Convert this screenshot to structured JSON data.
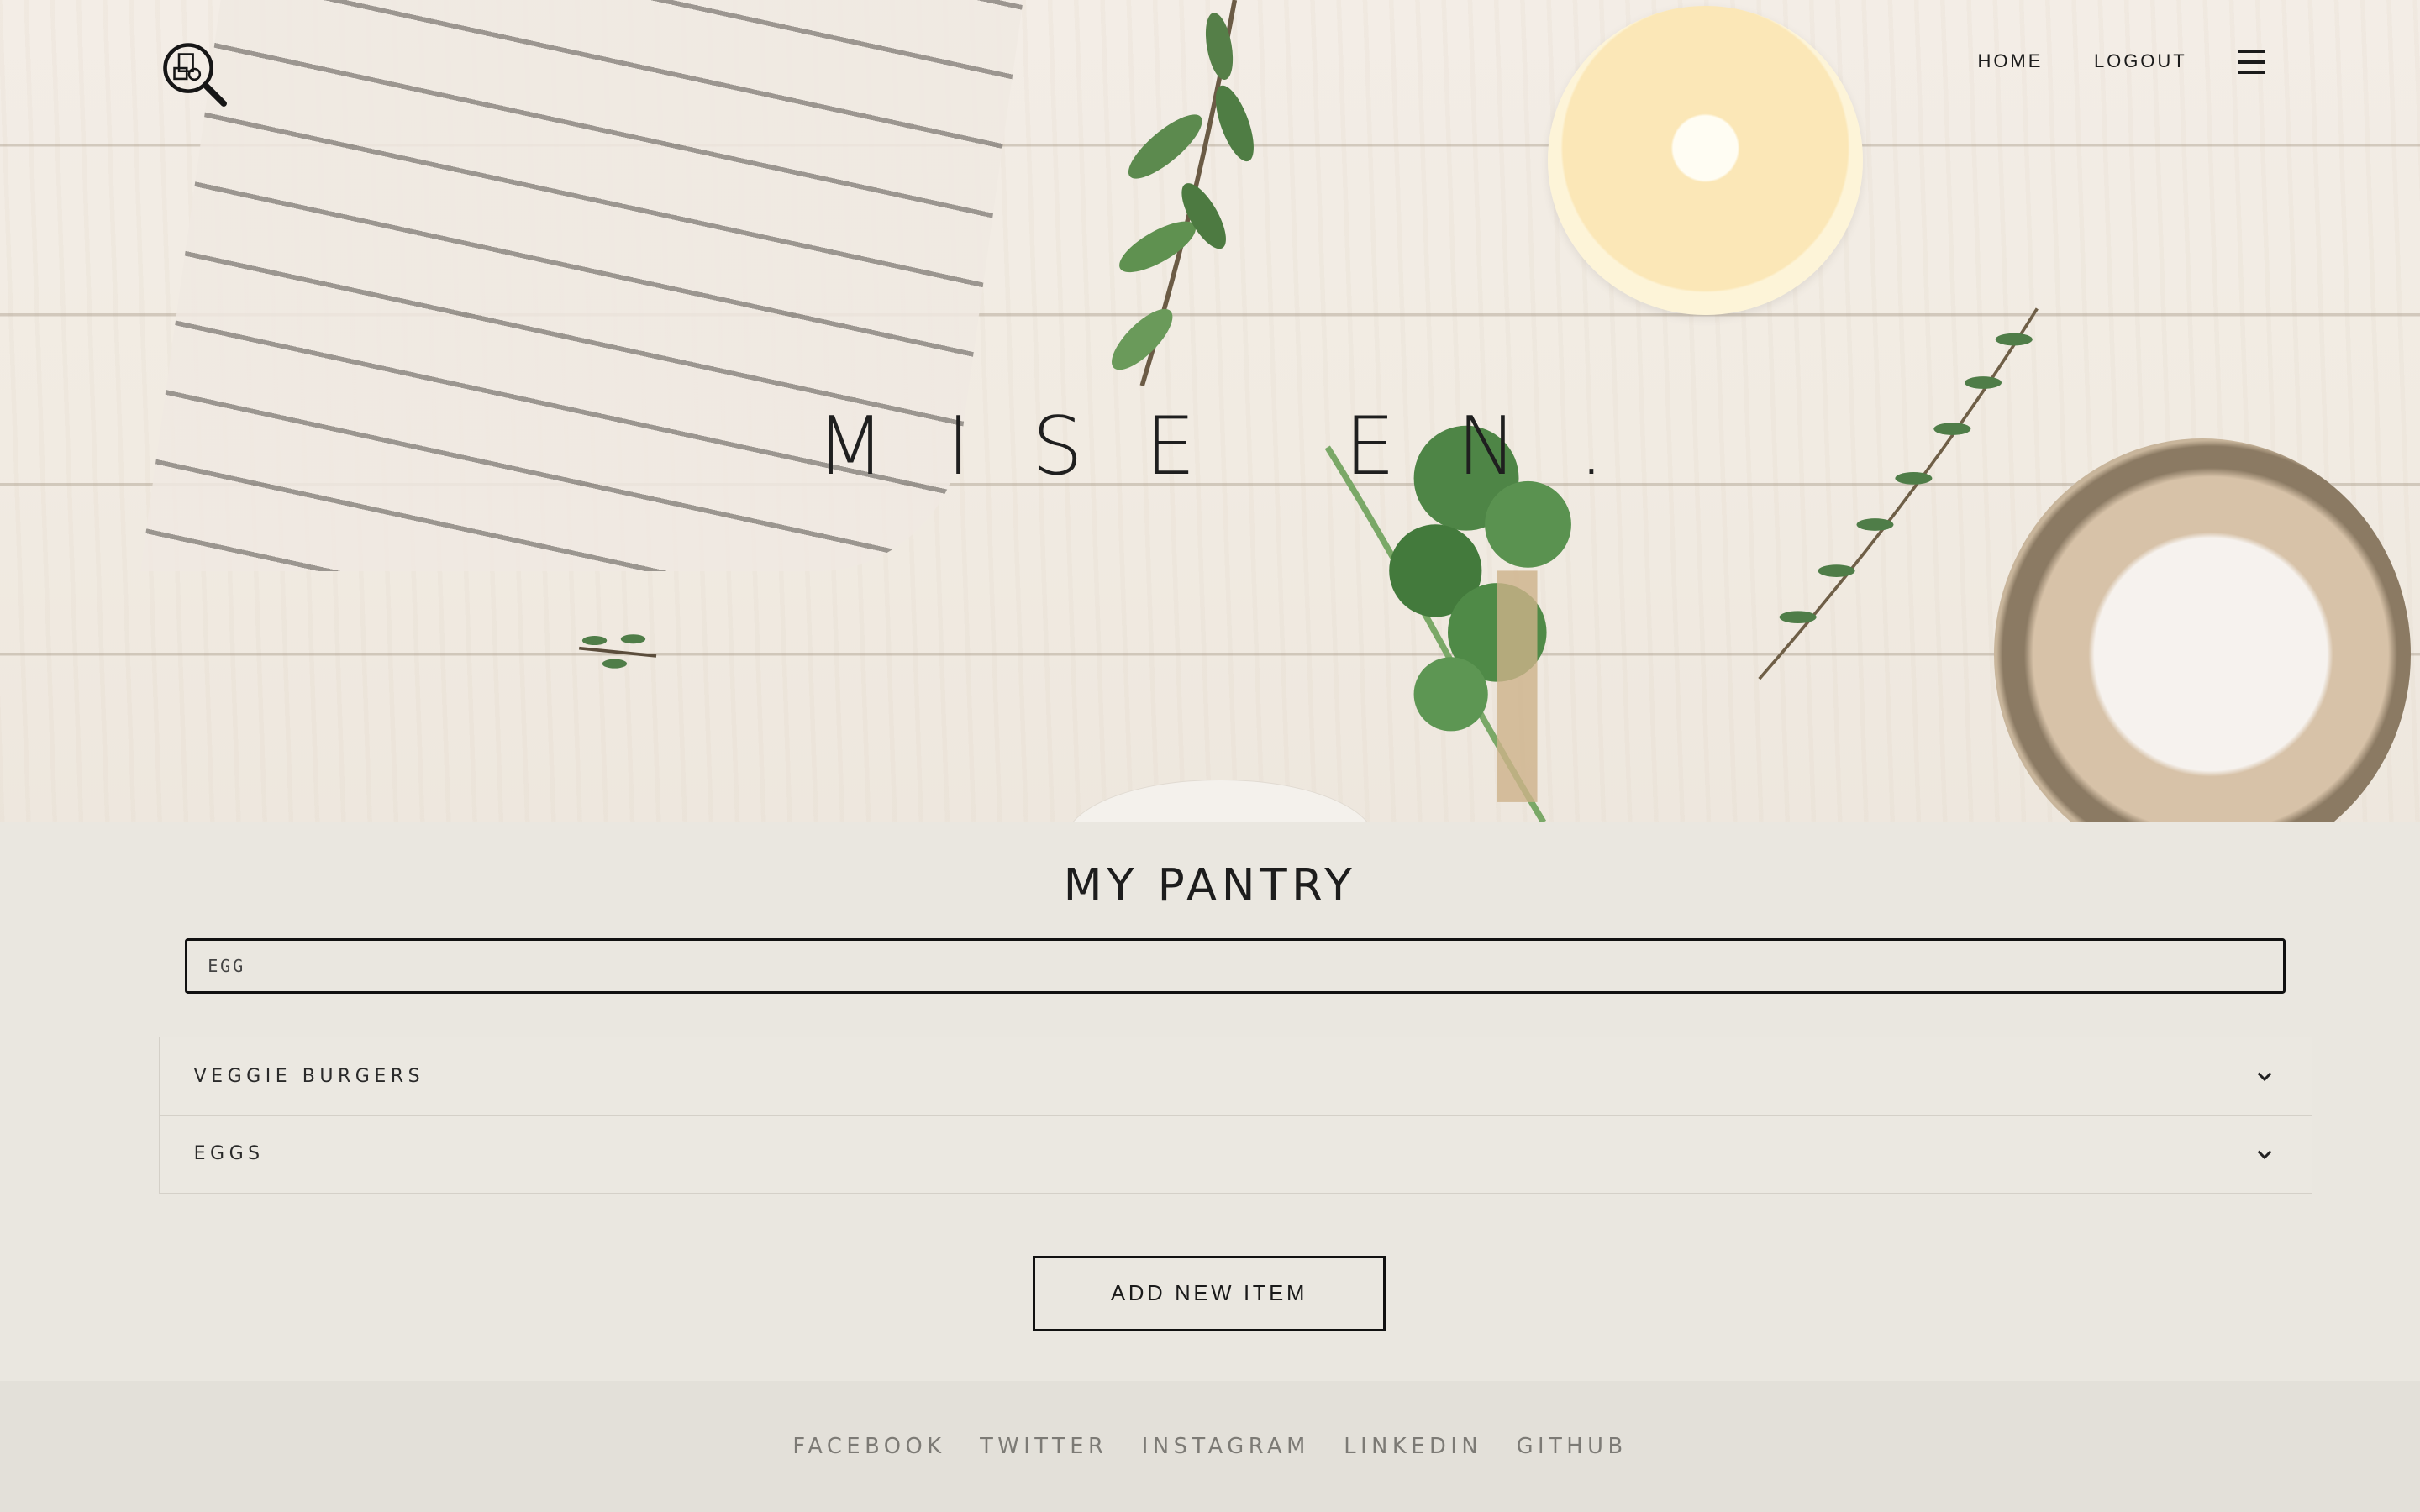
{
  "nav": {
    "logo_icon": "pantry-search-icon",
    "links": [
      {
        "label": "HOME"
      },
      {
        "label": "LOGOUT"
      }
    ],
    "menu_icon": "hamburger-menu-icon"
  },
  "hero": {
    "title": "MISE EN."
  },
  "pantry": {
    "heading": "MY PANTRY",
    "search_value": "EGG",
    "items": [
      {
        "label": "VEGGIE BURGERS",
        "icon": "chevron-down-icon"
      },
      {
        "label": "EGGS",
        "icon": "chevron-down-icon"
      }
    ],
    "add_button": "ADD NEW ITEM"
  },
  "footer": {
    "links": [
      "FACEBOOK",
      "TWITTER",
      "INSTAGRAM",
      "LINKEDIN",
      "GITHUB"
    ]
  }
}
